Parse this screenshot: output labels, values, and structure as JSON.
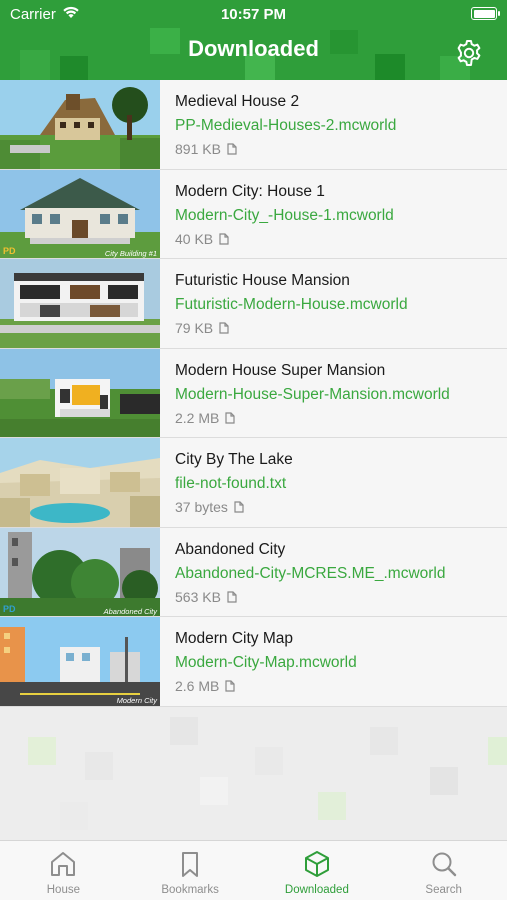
{
  "status_bar": {
    "carrier": "Carrier",
    "time": "10:57 PM"
  },
  "header": {
    "title": "Downloaded",
    "settings_icon": "gear-icon"
  },
  "items": [
    {
      "title": "Medieval House 2",
      "file": "PP-Medieval-Houses-2.mcworld",
      "size": "891 KB"
    },
    {
      "title": "Modern City: House 1",
      "file": "Modern-City_-House-1.mcworld",
      "size": "40 KB"
    },
    {
      "title": "Futuristic House Mansion",
      "file": "Futuristic-Modern-House.mcworld",
      "size": "79 KB"
    },
    {
      "title": "Modern House Super Mansion",
      "file": "Modern-House-Super-Mansion.mcworld",
      "size": "2.2 MB"
    },
    {
      "title": "City By The Lake",
      "file": "file-not-found.txt",
      "size": "37 bytes"
    },
    {
      "title": "Abandoned City",
      "file": "Abandoned-City-MCRES.ME_.mcworld",
      "size": "563 KB"
    },
    {
      "title": "Modern City Map",
      "file": "Modern-City-Map.mcworld",
      "size": "2.6 MB"
    }
  ],
  "thumb_overlays": {
    "item1": {
      "badge": "PD",
      "caption": "City Building #1"
    },
    "item5": {
      "badge": "PD",
      "caption": "Abandoned City"
    },
    "item6": {
      "caption": "Modern City"
    }
  },
  "tabs": [
    {
      "label": "House",
      "icon": "house-icon",
      "active": false
    },
    {
      "label": "Bookmarks",
      "icon": "bookmark-icon",
      "active": false
    },
    {
      "label": "Downloaded",
      "icon": "cube-icon",
      "active": true
    },
    {
      "label": "Search",
      "icon": "search-icon",
      "active": false
    }
  ],
  "colors": {
    "accent": "#2f9e3a",
    "file_text": "#3aa83f",
    "inactive_tab": "#8e8e8e"
  }
}
